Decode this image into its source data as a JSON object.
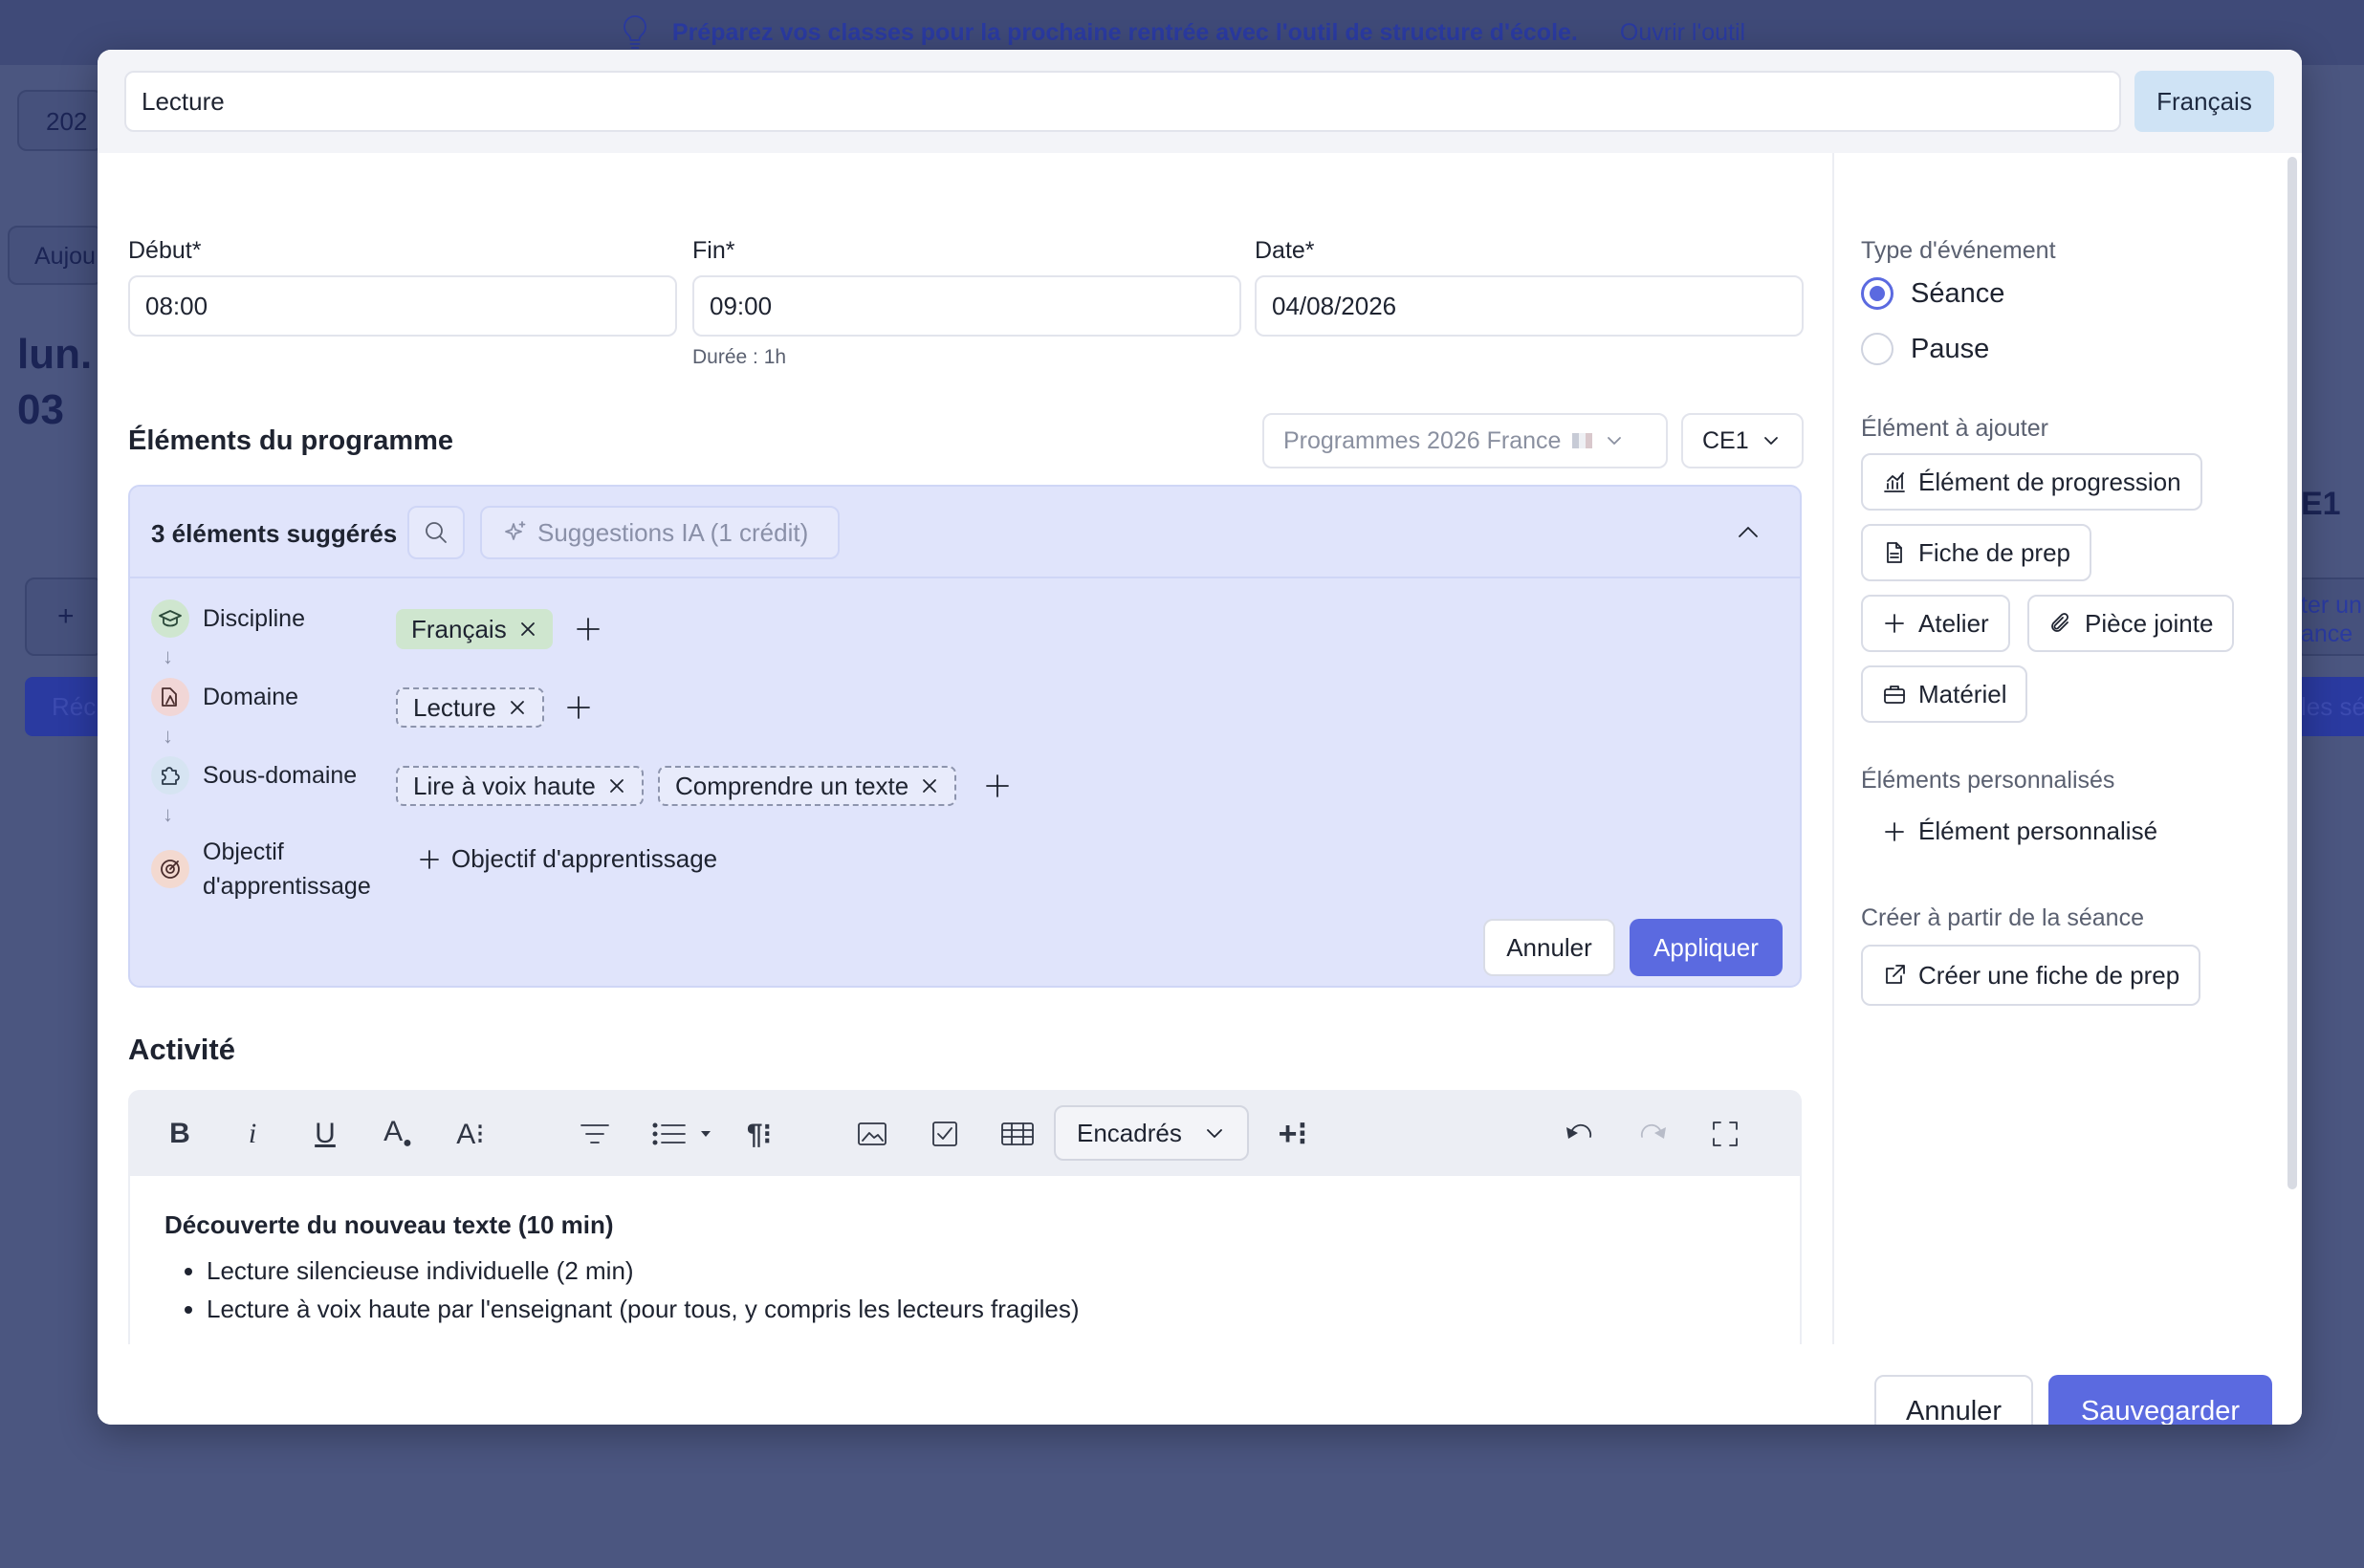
{
  "banner": {
    "text": "Préparez vos classes pour la prochaine rentrée avec l'outil de structure d'école.",
    "link": "Ouvrir l'outil"
  },
  "background": {
    "year_fragment": "202",
    "today_fragment": "Aujou",
    "day_fragment": "lun.",
    "date_fragment": "03",
    "class_fragment": "E1",
    "add_fragment": "ter un",
    "add_fragment2": "ance",
    "rec_fragment": "Réc",
    "seances_fragment": "les sé"
  },
  "modal": {
    "title_value": "Lecture",
    "subject_badge": "Français",
    "start": {
      "label": "Début*",
      "value": "08:00"
    },
    "end": {
      "label": "Fin*",
      "value": "09:00",
      "hint": "Durée : 1h"
    },
    "date": {
      "label": "Date*",
      "value": "04/08/2026"
    },
    "programme": {
      "heading": "Éléments du programme",
      "programme_select": "Programmes 2026 France",
      "level_select": "CE1",
      "suggested_count": "3 éléments suggérés",
      "ai_button": "Suggestions IA (1 crédit)",
      "rows": [
        {
          "label": "Discipline",
          "chips": [
            "Français"
          ]
        },
        {
          "label": "Domaine",
          "chips": [
            "Lecture"
          ]
        },
        {
          "label": "Sous-domaine",
          "chips": [
            "Lire à voix haute",
            "Comprendre un texte"
          ]
        },
        {
          "label_line1": "Objectif",
          "label_line2": "d'apprentissage",
          "add_label": "Objectif d'apprentissage"
        }
      ],
      "cancel": "Annuler",
      "apply": "Appliquer"
    },
    "activity": {
      "heading": "Activité",
      "encadres": "Encadrés",
      "content_title": "Découverte du nouveau texte (10 min)",
      "bullets": [
        "Lecture silencieuse individuelle (2 min)",
        "Lecture à voix haute par l'enseignant (pour tous, y compris les lecteurs fragiles)"
      ]
    },
    "sidebar": {
      "event_type_label": "Type d'événement",
      "event_types": [
        "Séance",
        "Pause"
      ],
      "selected_event_type": "Séance",
      "add_label": "Élément à ajouter",
      "add_buttons": [
        "Élément de progression",
        "Fiche de prep",
        "Atelier",
        "Pièce jointe",
        "Matériel"
      ],
      "custom_label": "Éléments personnalisés",
      "custom_button": "Élément personnalisé",
      "create_label": "Créer à partir de la séance",
      "create_button": "Créer une fiche de prep"
    },
    "footer": {
      "cancel": "Annuler",
      "save": "Sauvegarder"
    }
  },
  "colors": {
    "primary": "#5b6ae0",
    "suggest_bg": "#e0e4fb",
    "chip_discipline": "#cfe6cf",
    "badge": "#cfe3f5",
    "overlay": "#4b5680"
  }
}
